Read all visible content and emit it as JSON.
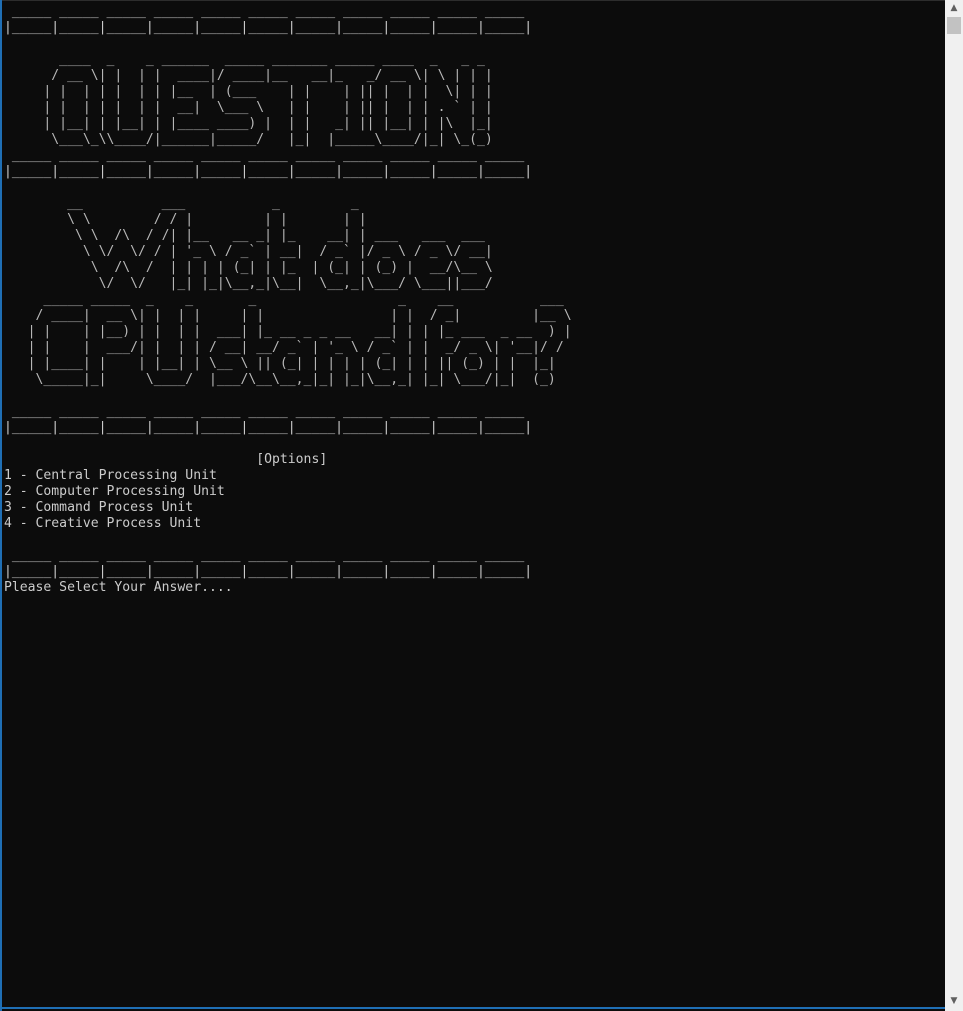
{
  "console": {
    "lines": [
      " _____ _____ _____ _____ _____ _____ _____ _____ _____ _____ _____",
      "|_____|_____|_____|_____|_____|_____|_____|_____|_____|_____|_____|",
      "",
      "       ____  _    _ ______  _____ _______ _____ ____  _   _ _",
      "      / __ \\| |  | |  ____|/ ____|__   __|_   _/ __ \\| \\ | | |",
      "     | |  | | |  | | |__  | (___    | |    | || |  | |  \\| | |",
      "     | |  | | |  | |  __|  \\___ \\   | |    | || |  | | . ` | |",
      "     | |__| | |__| | |____ ____) |  | |   _| || |__| | |\\  |_|",
      "      \\___\\_\\\\____/|______|_____/   |_|  |_____\\____/|_| \\_(_)",
      " _____ _____ _____ _____ _____ _____ _____ _____ _____ _____ _____",
      "|_____|_____|_____|_____|_____|_____|_____|_____|_____|_____|_____|",
      "",
      "        __          ___           _         _",
      "        \\ \\        / / |         | |       | |",
      "         \\ \\  /\\  / /| |__   __ _| |_    __| | ___   ___  ___",
      "          \\ \\/  \\/ / | '_ \\ / _` | __|  / _` |/ _ \\ / _ \\/ __|",
      "           \\  /\\  /  | | | | (_| | |_  | (_| | (_) |  __/\\__ \\",
      "            \\/  \\/   |_| |_|\\__,_|\\__|  \\__,_|\\___/ \\___||___/",
      "     _____ _____  _    _       _                  _    __           ___",
      "    / ____|  __ \\| |  | |     | |                | |  / _|         |__ \\",
      "   | |    | |__) | |  | |  ___| |_ __ _ _ __   __| | | |_ ___  _ __  ) |",
      "   | |    |  ___/| |  | | / __| __/ _` | '_ \\ / _` | |  _/ _ \\| '__|/ /",
      "   | |____| |    | |__| | \\__ \\ || (_| | | | | (_| | | || (_) | |  |_|",
      "    \\_____|_|     \\____/  |___/\\__\\__,_|_| |_|\\__,_| |_| \\___/|_|  (_)",
      "",
      " _____ _____ _____ _____ _____ _____ _____ _____ _____ _____ _____",
      "|_____|_____|_____|_____|_____|_____|_____|_____|_____|_____|_____|",
      "",
      "                                [Options]",
      "1 - Central Processing Unit",
      "2 - Computer Processing Unit",
      "3 - Command Process Unit",
      "4 - Creative Process Unit",
      "",
      " _____ _____ _____ _____ _____ _____ _____ _____ _____ _____ _____",
      "|_____|_____|_____|_____|_____|_____|_____|_____|_____|_____|_____|",
      "Please Select Your Answer...."
    ]
  },
  "scrollbar": {
    "up_icon": "triangle-up",
    "down_icon": "triangle-down",
    "up_glyph": "▲",
    "down_glyph": "▼"
  },
  "colors": {
    "background": "#0c0c0c",
    "text": "#cccccc",
    "accent_border": "#1f6fb5",
    "scrollbar_track": "#f0f0f0",
    "scrollbar_thumb": "#c2c2c2"
  }
}
